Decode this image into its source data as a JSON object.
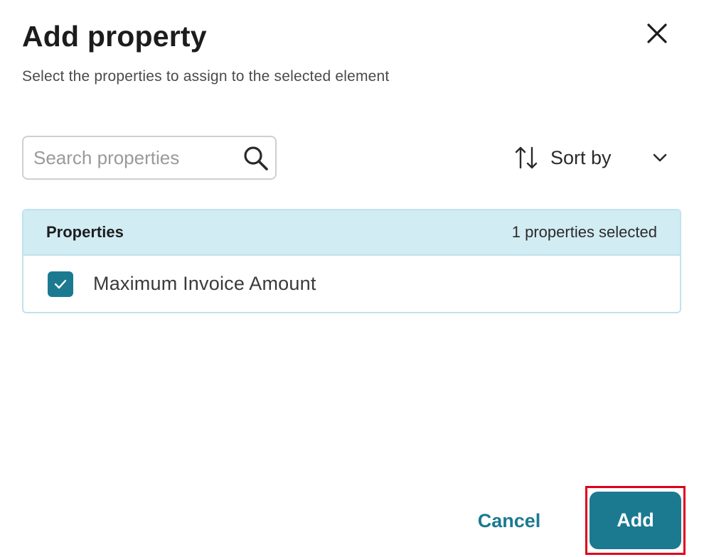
{
  "dialog": {
    "title": "Add property",
    "subtitle": "Select the properties to assign to the selected element",
    "close_icon": "close-icon"
  },
  "search": {
    "placeholder": "Search properties",
    "value": "",
    "icon": "search-icon"
  },
  "sort": {
    "label": "Sort by",
    "icon": "sort-arrows-icon",
    "dropdown_icon": "chevron-down-icon"
  },
  "table": {
    "header": "Properties",
    "selected_count_text": "1 properties selected",
    "rows": [
      {
        "label": "Maximum Invoice Amount",
        "checked": true
      }
    ]
  },
  "footer": {
    "cancel_label": "Cancel",
    "add_label": "Add"
  },
  "colors": {
    "accent": "#1b7a90",
    "header_bg": "#d2ecf4",
    "border": "#bfe3ee",
    "highlight": "#e0001b"
  }
}
